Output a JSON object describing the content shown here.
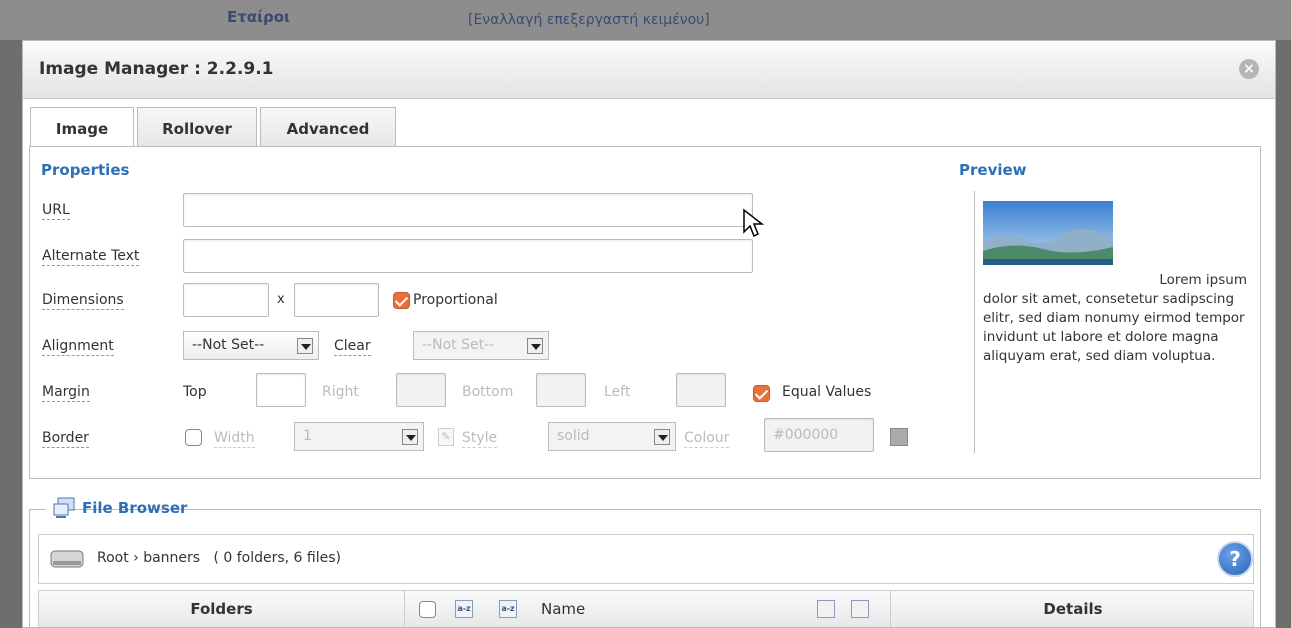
{
  "background": {
    "label_left": "Εταίροι",
    "label_right": "[Εναλλαγή επεξεργαστή κειμένου]"
  },
  "dialog": {
    "title": "Image Manager : 2.2.9.1",
    "close_icon": "close-icon"
  },
  "tabs": [
    {
      "label": "Image",
      "active": true
    },
    {
      "label": "Rollover",
      "active": false
    },
    {
      "label": "Advanced",
      "active": false
    }
  ],
  "properties": {
    "heading": "Properties",
    "url_label": "URL",
    "url_value": "",
    "alt_label": "Alternate Text",
    "alt_value": "",
    "dimensions_label": "Dimensions",
    "dimensions_separator": "x",
    "proportional_label": "Proportional",
    "proportional_checked": true,
    "alignment_label": "Alignment",
    "alignment_value": "--Not Set--",
    "clear_label": "Clear",
    "clear_value": "--Not Set--",
    "margin_label": "Margin",
    "margin_top": "Top",
    "margin_right": "Right",
    "margin_bottom": "Bottom",
    "margin_left": "Left",
    "equal_values_label": "Equal Values",
    "equal_values_checked": true,
    "border_label": "Border",
    "border_width_label": "Width",
    "border_width_value": "1",
    "border_style_label": "Style",
    "border_style_value": "solid",
    "border_colour_label": "Colour",
    "border_colour_value": "#000000"
  },
  "preview": {
    "heading": "Preview",
    "text_first": "Lorem ipsum",
    "text_rest": "dolor sit amet, consetetur sadipscing elitr, sed diam nonumy eirmod tempor invidunt ut labore et dolore magna aliquyam erat, sed diam voluptua."
  },
  "file_browser": {
    "legend": "File Browser",
    "path": "Root › banners   ( 0 folders, 6 files)",
    "help_label": "?",
    "columns": {
      "folders": "Folders",
      "name": "Name",
      "details": "Details"
    },
    "sort_icon_text": "a-z"
  },
  "colors": {
    "accent": "#2e6fb5",
    "check": "#e8703a"
  }
}
